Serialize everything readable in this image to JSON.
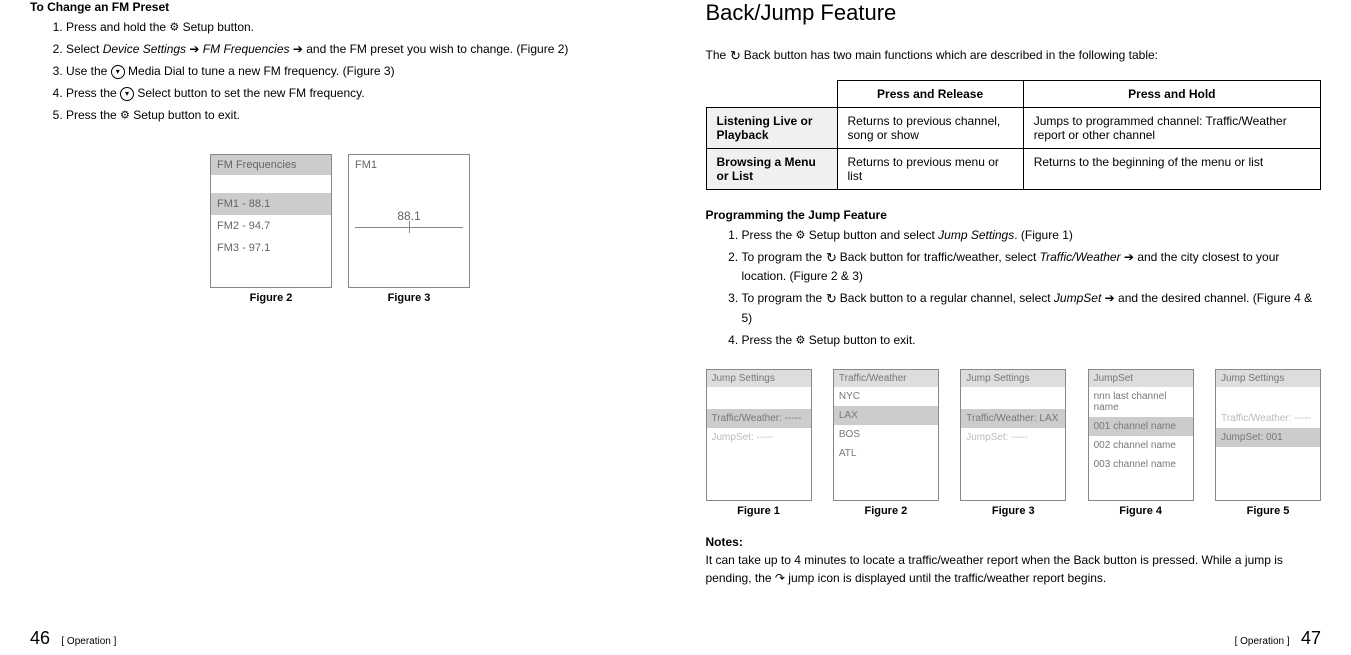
{
  "left": {
    "heading": "To Change an FM Preset",
    "steps": [
      {
        "pre": "Press and hold the ",
        "icon": "⚙",
        "post": " Setup button."
      },
      {
        "pre": "Select ",
        "i1": "Device Settings",
        "arr1": " ➔ ",
        "i2": "FM Frequencies",
        "arr2": " ➔ ",
        "post": "and the FM preset you wish to change. (Figure 2)"
      },
      {
        "pre": "Use the ",
        "dial": "◉",
        "post": " Media Dial to tune a new FM frequency. (Figure 3)"
      },
      {
        "pre": "Press the ",
        "dial": "◉",
        "post": " Select button to set the new FM frequency."
      },
      {
        "pre": "Press the ",
        "icon": "⚙",
        "post": " Setup button to exit."
      }
    ],
    "fig2": {
      "title": "FM Frequencies",
      "rows": [
        "FM1 - 88.1",
        "FM2 - 94.7",
        "FM3 - 97.1"
      ],
      "label": "Figure 2"
    },
    "fig3": {
      "title": "FM1",
      "freq": "88.1",
      "label": "Figure 3"
    },
    "footer": {
      "num": "46",
      "label": "[ Operation ]"
    }
  },
  "right": {
    "heading": "Back/Jump Feature",
    "intro_pre": "The ",
    "intro_icon": "↺",
    "intro_post": " Back button has two main functions which are described in the following table:",
    "table": {
      "col1": "Press and Release",
      "col2": "Press and Hold",
      "r1h": "Listening Live or Playback",
      "r1c1": "Returns to previous channel, song or show",
      "r1c2": "Jumps to programmed channel: Traffic/Weather report or other channel",
      "r2h": "Browsing a Menu or List",
      "r2c1": "Returns to previous menu or list",
      "r2c2": "Returns to the beginning of the menu or list"
    },
    "prog_heading": "Programming the Jump Feature",
    "steps": [
      {
        "pre": "Press the ",
        "icon": "⚙",
        "mid": " Setup button and select ",
        "i": "Jump Settings",
        "post": ". (Figure 1)"
      },
      {
        "pre": "To program the ",
        "back": "↺",
        "mid": " Back button for traffic/weather, select ",
        "i": "Traffic/Weather",
        "arr": " ➔ ",
        "post": "and the city closest to your location. (Figure 2 & 3)"
      },
      {
        "pre": "To program the ",
        "back": "↺",
        "mid": " Back button to a regular channel, select ",
        "i": "JumpSet",
        "arr": " ➔ ",
        "post": "and the desired channel. (Figure 4 & 5)"
      },
      {
        "pre": "Press the ",
        "icon": "⚙",
        "post": " Setup button to exit."
      }
    ],
    "figs": [
      {
        "title": "Jump Settings",
        "rows": [
          {
            "t": "Traffic/Weather: -----",
            "hl": true
          },
          {
            "t": "JumpSet: -----",
            "dim": true
          }
        ],
        "gap": true,
        "label": "Figure 1"
      },
      {
        "title": "Traffic/Weather",
        "rows": [
          {
            "t": "NYC"
          },
          {
            "t": "LAX",
            "hl": true
          },
          {
            "t": "BOS"
          },
          {
            "t": "ATL"
          }
        ],
        "label": "Figure 2"
      },
      {
        "title": "Jump Settings",
        "rows": [
          {
            "t": "Traffic/Weather: LAX",
            "hl": true
          },
          {
            "t": "JumpSet: -----",
            "dim": true
          }
        ],
        "gap": true,
        "label": "Figure 3"
      },
      {
        "title": "JumpSet",
        "rows": [
          {
            "t": "nnn last channel name"
          },
          {
            "t": "001 channel name",
            "hl": true
          },
          {
            "t": "002 channel name"
          },
          {
            "t": "003 channel name"
          }
        ],
        "label": "Figure 4"
      },
      {
        "title": "Jump Settings",
        "rows": [
          {
            "t": "Traffic/Weather: -----",
            "dim": true
          },
          {
            "t": "JumpSet: 001",
            "hl": true
          }
        ],
        "gap": true,
        "label": "Figure 5"
      }
    ],
    "notes_h": "Notes:",
    "notes_p_pre": "It can take up to 4 minutes to locate a traffic/weather report when the Back button is pressed. While a jump is pending, the ",
    "notes_icon": "↷",
    "notes_p_post": " jump icon is displayed until the traffic/weather report begins.",
    "footer": {
      "num": "47",
      "label": "[ Operation ]"
    }
  }
}
